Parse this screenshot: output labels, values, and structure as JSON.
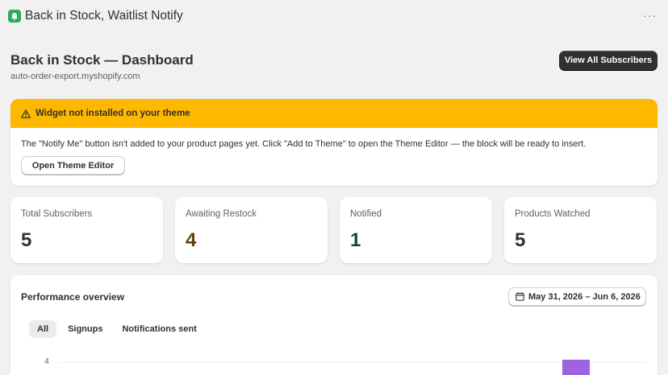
{
  "app": {
    "name": "Back in Stock, Waitlist Notify",
    "more_label": "···"
  },
  "header": {
    "title": "Back in Stock — Dashboard",
    "store": "auto-order-export.myshopify.com",
    "view_all_label": "View All Subscribers"
  },
  "banner": {
    "title": "Widget not installed on your theme",
    "body": "The \"Notify Me\" button isn't added to your product pages yet. Click \"Add to Theme\" to open the Theme Editor — the block will be ready to insert.",
    "button_label": "Open Theme Editor",
    "color": "#ffb800",
    "icon": "warning-icon"
  },
  "stats": [
    {
      "label": "Total Subscribers",
      "value": "5",
      "color": "#303030"
    },
    {
      "label": "Awaiting Restock",
      "value": "4",
      "color": "#5e4200"
    },
    {
      "label": "Notified",
      "value": "1",
      "color": "#0c5132"
    },
    {
      "label": "Products Watched",
      "value": "5",
      "color": "#303030"
    }
  ],
  "performance": {
    "title": "Performance overview",
    "date_range": "May 31, 2026 – Jun 6, 2026",
    "date_icon": "calendar-icon",
    "tabs": [
      "All",
      "Signups",
      "Notifications sent"
    ],
    "active_tab": "All",
    "chart_data": {
      "type": "bar",
      "y_tick_labels": [
        "4"
      ],
      "bar_color": "#9d63e0",
      "visible_bar_value": 4
    }
  }
}
